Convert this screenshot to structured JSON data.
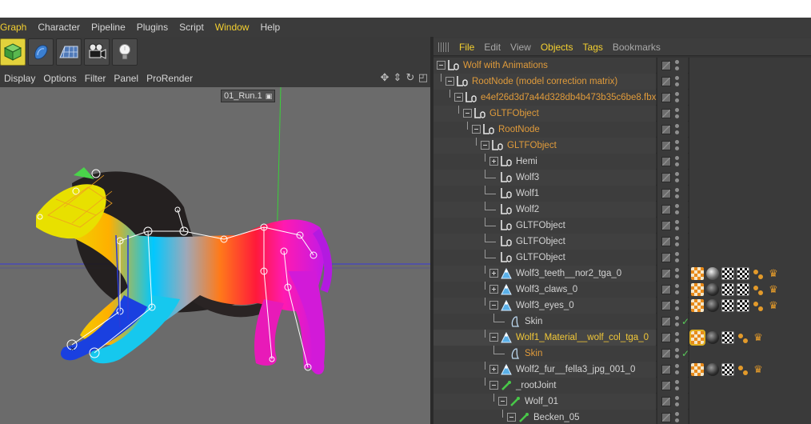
{
  "main_menu": [
    "Graph",
    "Character",
    "Pipeline",
    "Plugins",
    "Script",
    "Window",
    "Help"
  ],
  "main_menu_highlight": [
    "Graph",
    "Window"
  ],
  "toolbar": [
    "cube-icon",
    "nurbs-icon",
    "floor-icon",
    "camera-icon",
    "light-icon"
  ],
  "viewport": {
    "menu": [
      "Display",
      "Options",
      "Filter",
      "Panel",
      "ProRender"
    ],
    "take_label": "01_Run.1",
    "nav_icons": [
      "move-icon",
      "pan-icon",
      "rotate-icon",
      "maximize-icon"
    ]
  },
  "object_manager": {
    "menu": [
      "File",
      "Edit",
      "View",
      "Objects",
      "Tags",
      "Bookmarks"
    ],
    "active_menu": [
      "File",
      "Objects",
      "Tags"
    ],
    "rows": [
      {
        "name": "Wolf with Animations",
        "depth": 0,
        "tree": "minus",
        "icon": "null",
        "color": "orange",
        "tags": []
      },
      {
        "name": "RootNode (model correction matrix)",
        "depth": 1,
        "tree": "minus",
        "icon": "null",
        "color": "orange",
        "tags": []
      },
      {
        "name": "e4ef26d3d7a44d328db4b473b35c6be8.fbx",
        "depth": 2,
        "tree": "minus",
        "icon": "null",
        "color": "orange",
        "tags": []
      },
      {
        "name": "GLTFObject",
        "depth": 3,
        "tree": "minus",
        "icon": "null",
        "color": "orange",
        "tags": []
      },
      {
        "name": "RootNode",
        "depth": 4,
        "tree": "minus",
        "icon": "null",
        "color": "orange",
        "tags": []
      },
      {
        "name": "GLTFObject",
        "depth": 5,
        "tree": "minus",
        "icon": "null",
        "color": "orange",
        "tags": []
      },
      {
        "name": "Hemi",
        "depth": 6,
        "tree": "plus",
        "icon": "null",
        "color": "white",
        "tags": []
      },
      {
        "name": "Wolf3",
        "depth": 6,
        "tree": "none",
        "icon": "null",
        "color": "white",
        "tags": []
      },
      {
        "name": "Wolf1",
        "depth": 6,
        "tree": "none",
        "icon": "null",
        "color": "white",
        "tags": []
      },
      {
        "name": "Wolf2",
        "depth": 6,
        "tree": "none",
        "icon": "null",
        "color": "white",
        "tags": []
      },
      {
        "name": "GLTFObject",
        "depth": 6,
        "tree": "none",
        "icon": "null",
        "color": "white",
        "tags": []
      },
      {
        "name": "GLTFObject",
        "depth": 6,
        "tree": "none",
        "icon": "null",
        "color": "white",
        "tags": []
      },
      {
        "name": "GLTFObject",
        "depth": 6,
        "tree": "none",
        "icon": "null",
        "color": "white",
        "tags": []
      },
      {
        "name": "Wolf3_teeth__nor2_tga_0",
        "depth": 6,
        "tree": "plus",
        "icon": "mesh",
        "color": "white",
        "tags": [
          "tex",
          "sphere",
          "check-b",
          "check-b",
          "joints",
          "crown"
        ]
      },
      {
        "name": "Wolf3_claws_0",
        "depth": 6,
        "tree": "plus",
        "icon": "mesh",
        "color": "white",
        "tags": [
          "tex",
          "dark",
          "check-b",
          "check-b",
          "joints",
          "crown"
        ]
      },
      {
        "name": "Wolf3_eyes_0",
        "depth": 6,
        "tree": "minus",
        "icon": "mesh",
        "color": "white",
        "tags": [
          "tex",
          "dark",
          "check-b",
          "check-b",
          "joints",
          "crown"
        ]
      },
      {
        "name": "Skin",
        "depth": 7,
        "tree": "none",
        "icon": "skin",
        "color": "white",
        "tags": [],
        "check": true
      },
      {
        "name": "Wolf1_Material__wolf_col_tga_0",
        "depth": 6,
        "tree": "minus",
        "icon": "mesh",
        "color": "yellow",
        "tags": [
          "tex-sel",
          "dark",
          "check-b",
          "joints",
          "crown"
        ],
        "selected": true
      },
      {
        "name": "Skin",
        "depth": 7,
        "tree": "none",
        "icon": "skin",
        "color": "orange",
        "tags": [],
        "check": true
      },
      {
        "name": "Wolf2_fur__fella3_jpg_001_0",
        "depth": 6,
        "tree": "plus",
        "icon": "mesh",
        "color": "white",
        "tags": [
          "tex",
          "dark",
          "check-b",
          "joints",
          "crown"
        ]
      },
      {
        "name": "_rootJoint",
        "depth": 6,
        "tree": "minus",
        "icon": "joint",
        "color": "white",
        "tags": []
      },
      {
        "name": "Wolf_01",
        "depth": 7,
        "tree": "minus",
        "icon": "joint",
        "color": "white",
        "tags": []
      },
      {
        "name": "Becken_05",
        "depth": 8,
        "tree": "minus",
        "icon": "joint",
        "color": "white",
        "tags": []
      }
    ]
  },
  "colors": {
    "accent_yellow": "#f4d030",
    "object_orange": "#e09b3b",
    "panel_bg": "#3a3a3a",
    "viewport_bg": "#6b6b6b"
  }
}
